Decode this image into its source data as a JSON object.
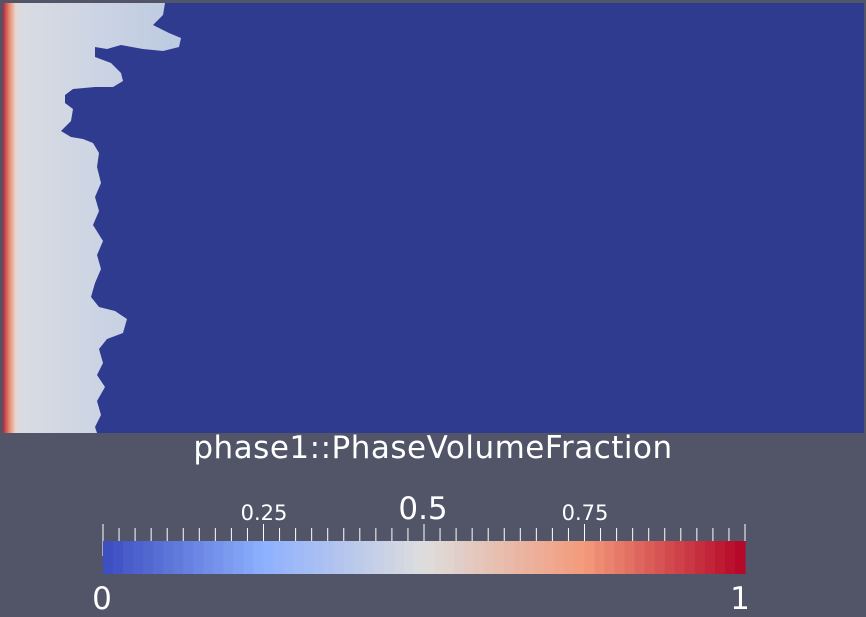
{
  "legend": {
    "title": "phase1::PhaseVolumeFraction",
    "labels": {
      "min": "0",
      "q1": "0.25",
      "mid": "0.5",
      "q3": "0.75",
      "max": "1"
    },
    "colormap": [
      "#3b4cc0",
      "#8db0fe",
      "#dddddd",
      "#f49a7b",
      "#b40426"
    ]
  },
  "colors": {
    "background": "#525568",
    "domain": "#2e3b8f",
    "phase_light": "#c9d3e4",
    "phase_wall": "#c0283a"
  }
}
